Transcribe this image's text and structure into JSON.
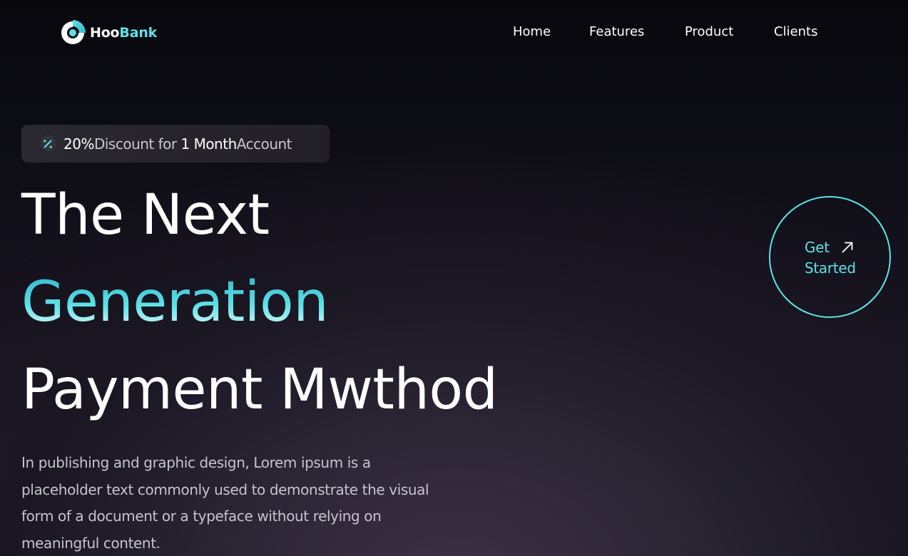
{
  "brand": {
    "name_part1": "Hoo",
    "name_part2": "Bank",
    "logo_icon": "hoobank-logo-icon"
  },
  "nav": {
    "items": [
      {
        "label": "Home"
      },
      {
        "label": "Features"
      },
      {
        "label": "Product"
      },
      {
        "label": "Clients"
      }
    ]
  },
  "discount": {
    "icon": "discount-percent-icon",
    "value": "20%",
    "text1": "Discount for ",
    "duration": "1 Month",
    "text2": "Account"
  },
  "hero": {
    "line1": "The Next",
    "line2": "Generation",
    "line3": "Payment Mwthod",
    "description": "In publishing and graphic design, Lorem ipsum is a placeholder text commonly used to demonstrate the visual form of a document or a typeface without relying on meaningful content."
  },
  "cta": {
    "line1": "Get",
    "line2": "Started",
    "icon": "arrow-up-right-icon"
  },
  "colors": {
    "accent": "#5ce1e6",
    "background": "#100e18",
    "text": "#ffffff",
    "muted_text": "#c6c2cf"
  }
}
